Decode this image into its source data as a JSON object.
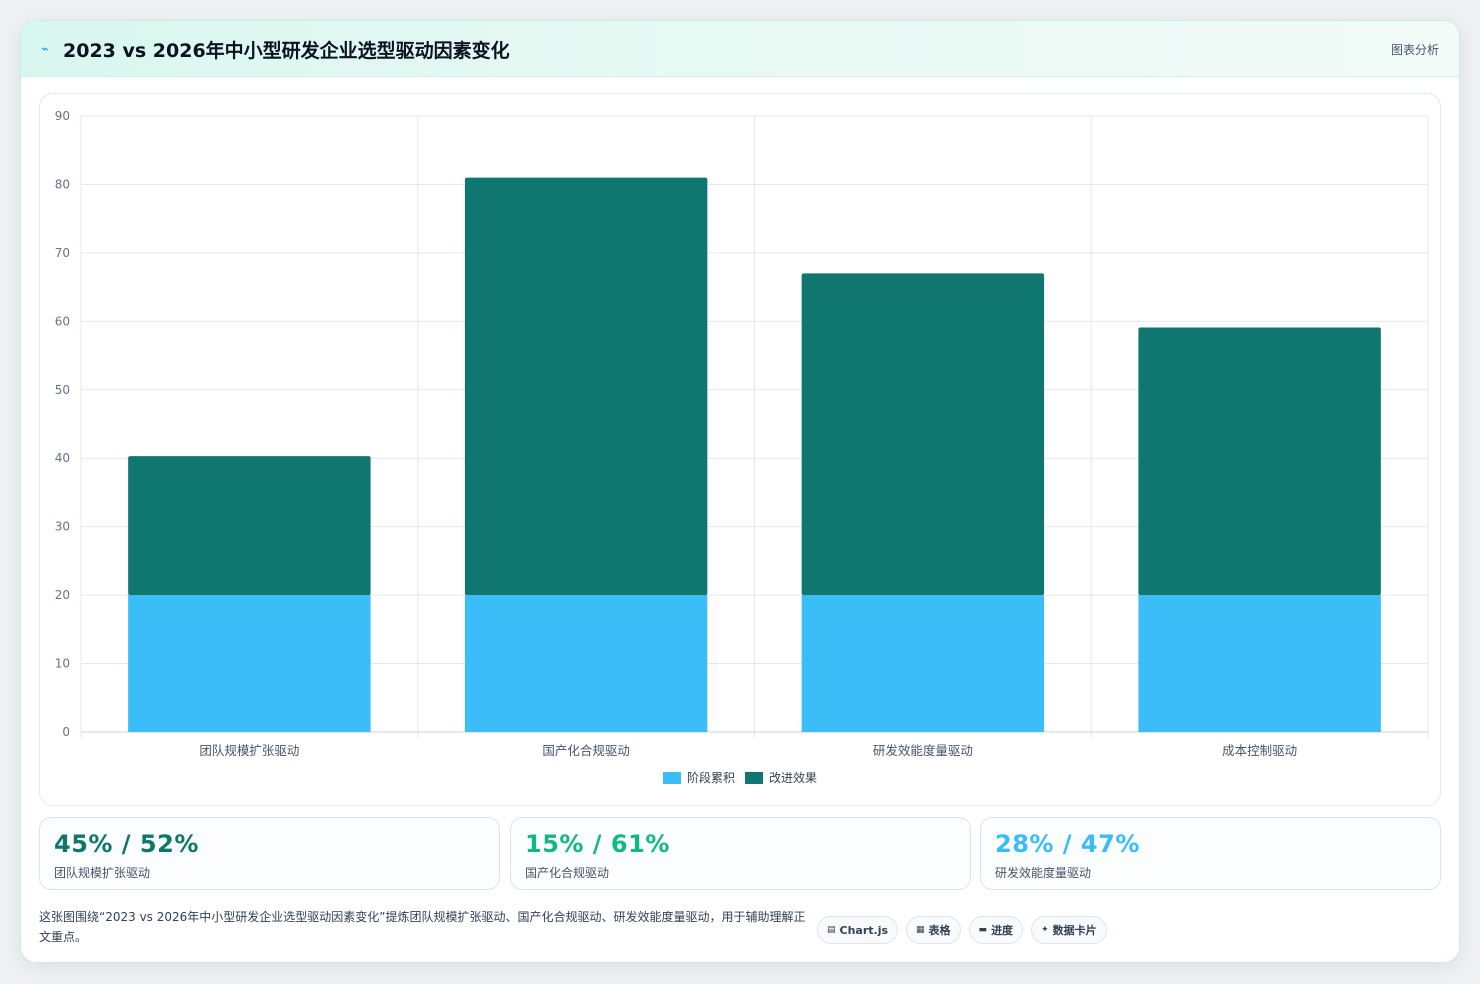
{
  "header": {
    "icon": "chart-line-icon",
    "title": "2023 vs 2026年中小型研发企业选型驱动因素变化",
    "action_label": "图表分析"
  },
  "chart_data": {
    "type": "bar",
    "stacked": true,
    "categories": [
      "团队规模扩张驱动",
      "国产化合规驱动",
      "研发效能度量驱动",
      "成本控制驱动"
    ],
    "series": [
      {
        "name": "阶段累积",
        "values": [
          20,
          20,
          20,
          20
        ],
        "color": "#3bbdf8"
      },
      {
        "name": "改进效果",
        "values": [
          20.3,
          61,
          47,
          39.1
        ],
        "color": "#107770"
      }
    ],
    "ylim": [
      0,
      90
    ],
    "yticks": [
      0,
      10,
      20,
      30,
      40,
      50,
      60,
      70,
      80,
      90
    ],
    "grid": true,
    "legend_position": "bottom"
  },
  "stats": [
    {
      "value": "45% / 52%",
      "label": "团队规模扩张驱动",
      "color": "#0f766e"
    },
    {
      "value": "15% / 61%",
      "label": "国产化合规驱动",
      "color": "#10b981"
    },
    {
      "value": "28% / 47%",
      "label": "研发效能度量驱动",
      "color": "#38bdf8"
    }
  ],
  "footnote": "这张图围绕“2023 vs 2026年中小型研发企业选型驱动因素变化”提炼团队规模扩张驱动、国产化合规驱动、研发效能度量驱动，用于辅助理解正文重点。",
  "chips": [
    {
      "icon": "chart-icon",
      "glyph": "▤",
      "label": "Chart.js"
    },
    {
      "icon": "table-icon",
      "glyph": "▦",
      "label": "表格"
    },
    {
      "icon": "progress-icon",
      "glyph": "▬",
      "label": "进度"
    },
    {
      "icon": "sparkle-icon",
      "glyph": "✦",
      "label": "数据卡片"
    }
  ]
}
